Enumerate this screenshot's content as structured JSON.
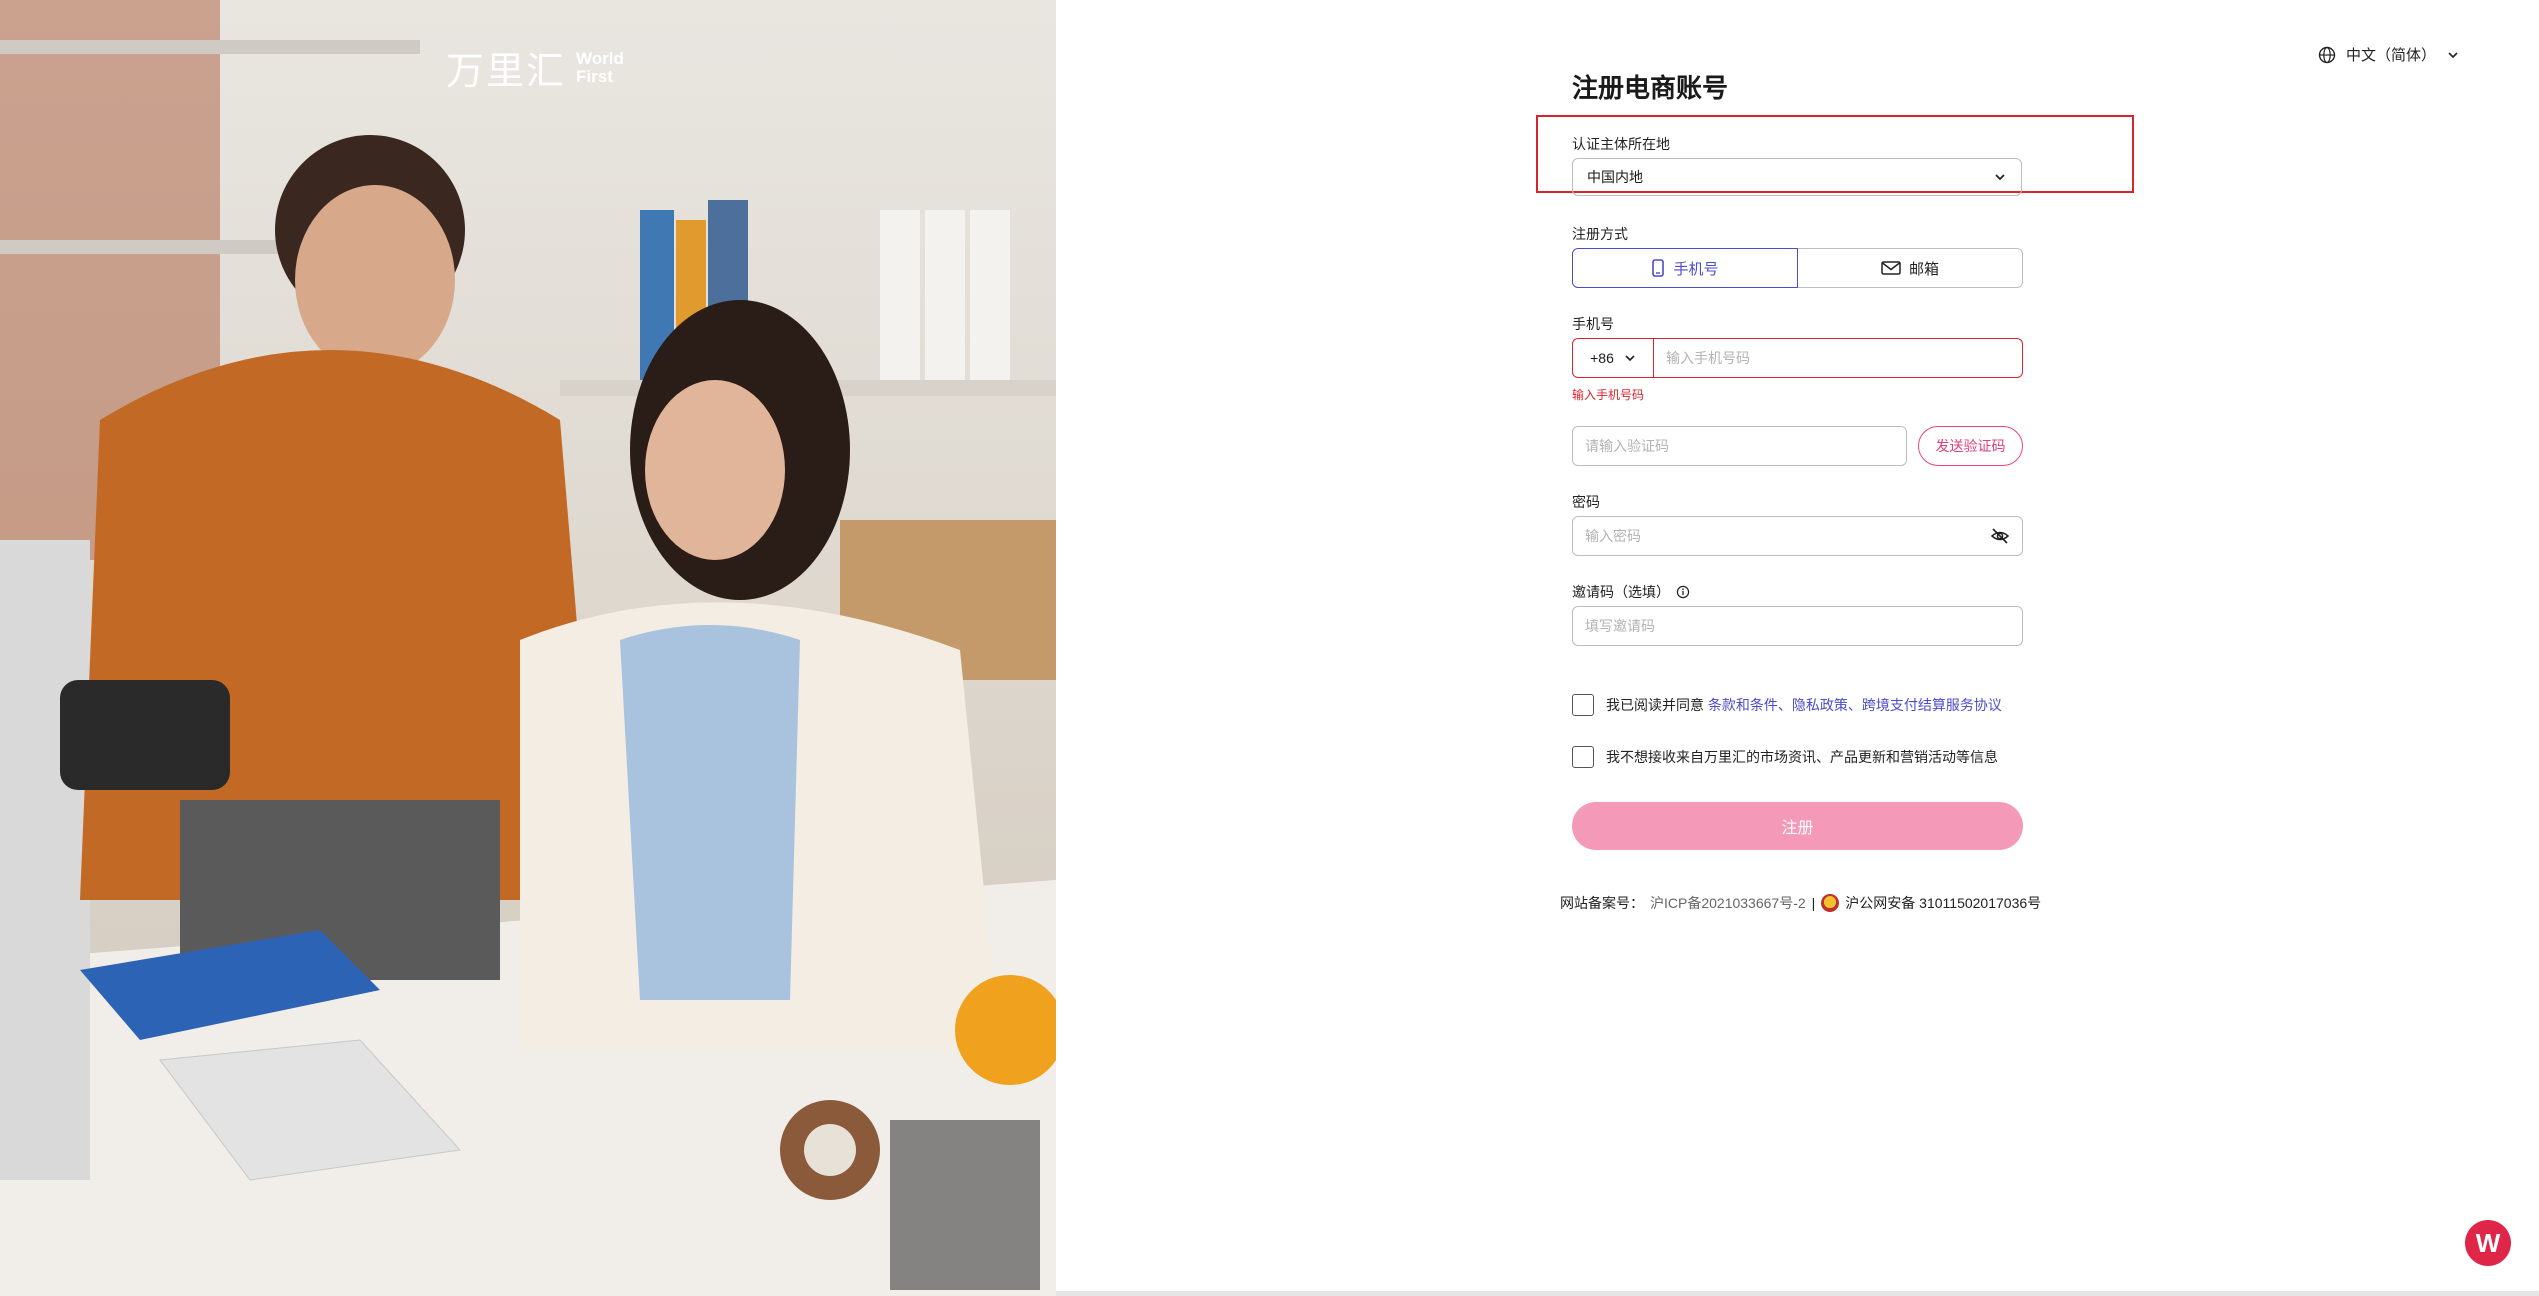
{
  "brand": {
    "logo_cn": "万里汇",
    "logo_en_line1": "World",
    "logo_en_line2": "First"
  },
  "language": {
    "label": "中文（简体）",
    "icon": "globe-icon"
  },
  "form": {
    "title": "注册电商账号",
    "region": {
      "label": "认证主体所在地",
      "value": "中国内地"
    },
    "method": {
      "label": "注册方式",
      "phone_tab": "手机号",
      "email_tab": "邮箱",
      "active": "phone"
    },
    "phone": {
      "label": "手机号",
      "country_code": "+86",
      "placeholder": "输入手机号码",
      "error": "输入手机号码"
    },
    "code": {
      "placeholder": "请输入验证码",
      "send_button": "发送验证码"
    },
    "password": {
      "label": "密码",
      "placeholder": "输入密码"
    },
    "invite": {
      "label": "邀请码（选填）",
      "placeholder": "填写邀请码"
    },
    "agree": {
      "prefix": "我已阅读并同意 ",
      "links": "条款和条件、隐私政策、跨境支付结算服务协议"
    },
    "optout": {
      "text": "我不想接收来自万里汇的市场资讯、产品更新和营销活动等信息"
    },
    "submit": "注册"
  },
  "footer": {
    "icp_label": "网站备案号：",
    "icp_value": "沪ICP备2021033667号-2",
    "separator": "|",
    "police": "沪公网安备 31011502017036号"
  },
  "colors": {
    "accent": "#4b4cc9",
    "error": "#d9232d",
    "brand_pink": "#f49ab8",
    "fab": "#e02648"
  },
  "fab": {
    "label": "W"
  }
}
